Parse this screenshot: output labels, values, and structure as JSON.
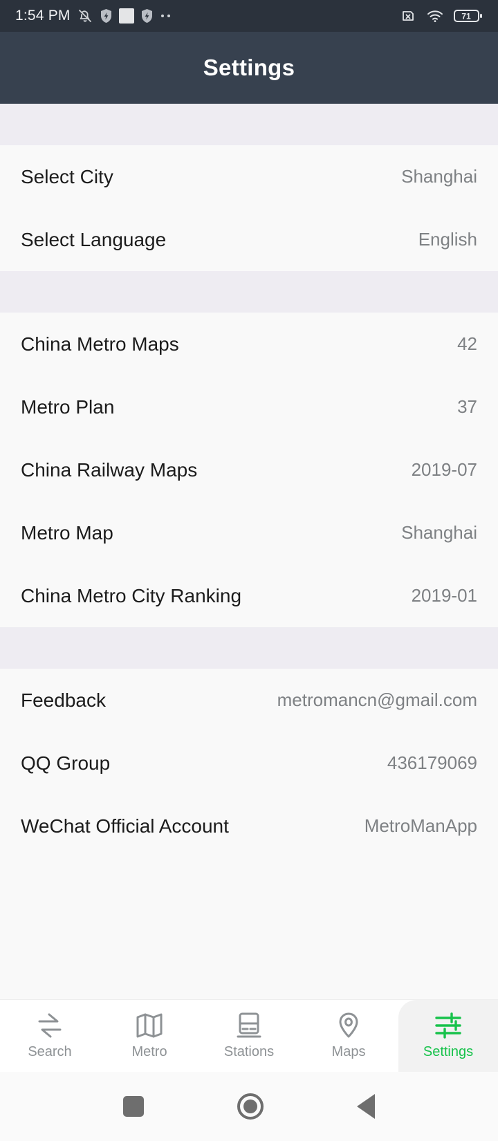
{
  "statusbar": {
    "time": "1:54 PM",
    "battery_level": "71",
    "icons": [
      "bell-muted-icon",
      "shield-icon",
      "white-square-icon",
      "shield-icon",
      "overflow-dots-icon",
      "sim-card-off-icon",
      "wifi-icon",
      "battery-icon"
    ]
  },
  "appbar": {
    "title": "Settings"
  },
  "sections": [
    {
      "rows": [
        {
          "label": "Select City",
          "value": "Shanghai"
        },
        {
          "label": "Select Language",
          "value": "English"
        }
      ]
    },
    {
      "rows": [
        {
          "label": "China Metro Maps",
          "value": "42"
        },
        {
          "label": "Metro Plan",
          "value": "37"
        },
        {
          "label": "China Railway Maps",
          "value": "2019-07"
        },
        {
          "label": "Metro Map",
          "value": "Shanghai"
        },
        {
          "label": "China Metro City Ranking",
          "value": "2019-01"
        }
      ]
    },
    {
      "rows": [
        {
          "label": "Feedback",
          "value": "metromancn@gmail.com"
        },
        {
          "label": "QQ Group",
          "value": "436179069"
        },
        {
          "label": "WeChat Official Account",
          "value": "MetroManApp"
        }
      ]
    }
  ],
  "tabbar": {
    "active_color": "#17c24b",
    "inactive_color": "#8e9295",
    "tabs": [
      {
        "label": "Search",
        "icon": "transfer-arrows-icon",
        "active": false
      },
      {
        "label": "Metro",
        "icon": "folded-map-icon",
        "active": false
      },
      {
        "label": "Stations",
        "icon": "train-car-icon",
        "active": false
      },
      {
        "label": "Maps",
        "icon": "location-pin-icon",
        "active": false
      },
      {
        "label": "Settings",
        "icon": "sliders-icon",
        "active": true
      }
    ]
  },
  "navbar": {
    "buttons": [
      {
        "name": "recents",
        "icon": "square-icon"
      },
      {
        "name": "home",
        "icon": "circle-icon"
      },
      {
        "name": "back",
        "icon": "triangle-left-icon"
      }
    ]
  }
}
